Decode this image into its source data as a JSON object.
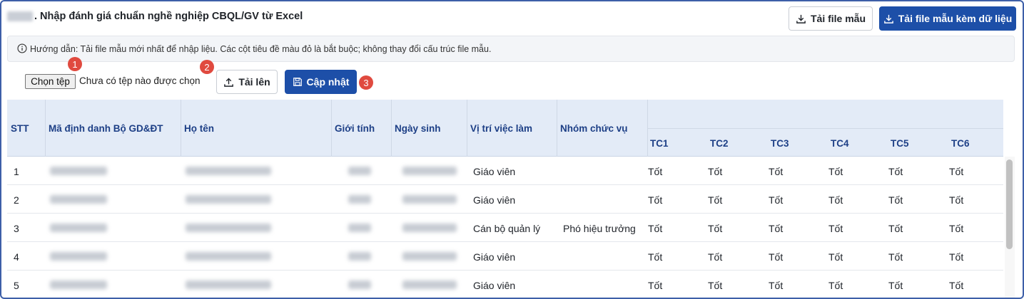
{
  "header": {
    "title": ". Nhập đánh giá chuẩn nghề nghiệp CBQL/GV từ Excel",
    "btn_template": "Tải file mẫu",
    "btn_template_data": "Tải file mẫu kèm dữ liệu"
  },
  "guide": {
    "text": "Hướng dẫn: Tải file mẫu mới nhất để nhập liệu. Các cột tiêu đề màu đỏ là bắt buộc; không thay đổi cấu trúc file mẫu."
  },
  "upload": {
    "choose_label": "Chọn tệp",
    "no_file": "Chưa có tệp nào được chọn",
    "upload_label": "Tải lên",
    "update_label": "Cập nhật",
    "badges": [
      "1",
      "2",
      "3"
    ]
  },
  "table": {
    "headers": {
      "stt": "STT",
      "id": "Mã định danh Bộ GD&ĐT",
      "name": "Họ tên",
      "gender": "Giới tính",
      "dob": "Ngày sinh",
      "position": "Vị trí việc làm",
      "group": "Nhóm chức vụ",
      "tc": [
        "TC1",
        "TC2",
        "TC3",
        "TC4",
        "TC5",
        "TC6"
      ]
    },
    "rows": [
      {
        "stt": "1",
        "position": "Giáo viên",
        "group": "",
        "tc": [
          "Tốt",
          "Tốt",
          "Tốt",
          "Tốt",
          "Tốt",
          "Tốt"
        ]
      },
      {
        "stt": "2",
        "position": "Giáo viên",
        "group": "",
        "tc": [
          "Tốt",
          "Tốt",
          "Tốt",
          "Tốt",
          "Tốt",
          "Tốt"
        ]
      },
      {
        "stt": "3",
        "position": "Cán bộ quản lý",
        "group": "Phó hiệu trưởng",
        "tc": [
          "Tốt",
          "Tốt",
          "Tốt",
          "Tốt",
          "Tốt",
          "Tốt"
        ]
      },
      {
        "stt": "4",
        "position": "Giáo viên",
        "group": "",
        "tc": [
          "Tốt",
          "Tốt",
          "Tốt",
          "Tốt",
          "Tốt",
          "Tốt"
        ]
      },
      {
        "stt": "5",
        "position": "Giáo viên",
        "group": "",
        "tc": [
          "Tốt",
          "Tốt",
          "Tốt",
          "Tốt",
          "Tốt",
          "Tốt"
        ]
      }
    ]
  },
  "colors": {
    "primary": "#1d4fa8",
    "badge": "#e04a3f",
    "header_bg": "#e3ebf7",
    "header_text": "#1d3f86"
  }
}
